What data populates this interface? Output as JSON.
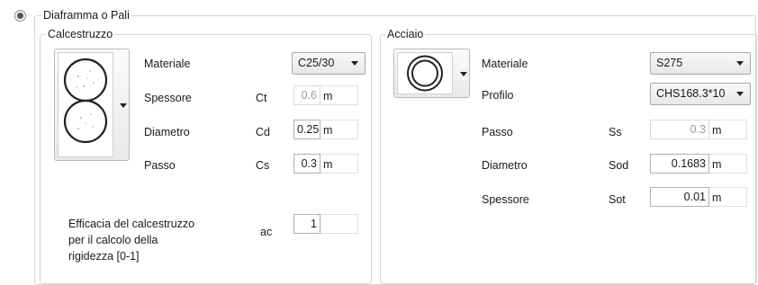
{
  "section": {
    "title": "Diaframma o Pali",
    "selected": true
  },
  "calcestruzzo": {
    "title": "Calcestruzzo",
    "materiale": {
      "label": "Materiale",
      "value": "C25/30"
    },
    "spessore": {
      "label": "Spessore",
      "symbol": "Ct",
      "value": "0.6",
      "unit": "m"
    },
    "diametro": {
      "label": "Diametro",
      "symbol": "Cd",
      "value": "0.25",
      "unit": "m"
    },
    "passo": {
      "label": "Passo",
      "symbol": "Cs",
      "value": "0.3",
      "unit": "m"
    },
    "efficacia": {
      "label_line1": "Efficacia del calcestruzzo",
      "label_line2": "per il calcolo della",
      "label_line3": "rigidezza  [0-1]",
      "symbol": "ac",
      "value": "1"
    }
  },
  "acciaio": {
    "title": "Acciaio",
    "materiale": {
      "label": "Materiale",
      "value": "S275"
    },
    "profilo": {
      "label": "Profilo",
      "value": "CHS168.3*10"
    },
    "passo": {
      "label": "Passo",
      "symbol": "Ss",
      "value": "0.3",
      "unit": "m"
    },
    "diametro": {
      "label": "Diametro",
      "symbol": "Sod",
      "value": "0.1683",
      "unit": "m"
    },
    "spessore": {
      "label": "Spessore",
      "symbol": "Sot",
      "value": "0.01",
      "unit": "m"
    }
  }
}
